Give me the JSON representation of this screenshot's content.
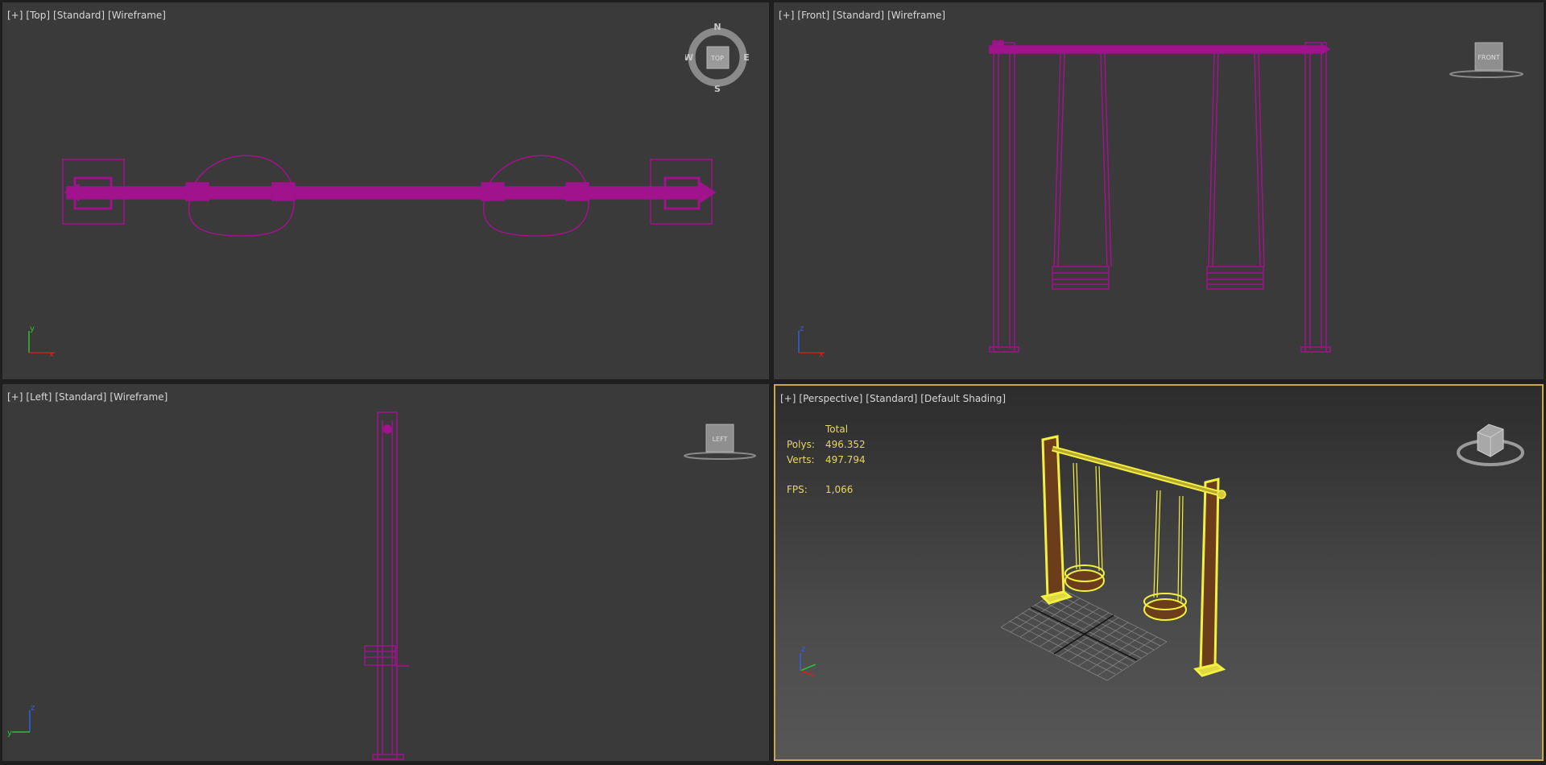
{
  "viewports": {
    "top": {
      "label": [
        "[+]",
        "[Top]",
        "[Standard]",
        "[Wireframe]"
      ],
      "compass": {
        "n": "N",
        "s": "S",
        "e": "E",
        "w": "W",
        "cube": "TOP"
      },
      "axes": {
        "up": "y",
        "right": "x"
      }
    },
    "front": {
      "label": [
        "[+]",
        "[Front]",
        "[Standard]",
        "[Wireframe]"
      ],
      "cube": "FRONT",
      "axes": {
        "up": "z",
        "right": "x"
      }
    },
    "left": {
      "label": [
        "[+]",
        "[Left]",
        "[Standard]",
        "[Wireframe]"
      ],
      "cube": "LEFT",
      "axes": {
        "up": "z",
        "right": "y"
      }
    },
    "perspective": {
      "label": [
        "[+]",
        "[Perspective]",
        "[Standard]",
        "[Default Shading]"
      ],
      "axes": {
        "up": "z"
      },
      "stats": {
        "header": "Total",
        "polys_label": "Polys:",
        "polys": "496.352",
        "verts_label": "Verts:",
        "verts": "497.794",
        "fps_label": "FPS:",
        "fps": "1,066"
      }
    }
  },
  "colors": {
    "wireframe": "#a0138c",
    "selection": "#f2f040",
    "viewport_bg": "#3a3a3a",
    "active_border": "#c9a84a",
    "wood": "#6b3d1a"
  }
}
